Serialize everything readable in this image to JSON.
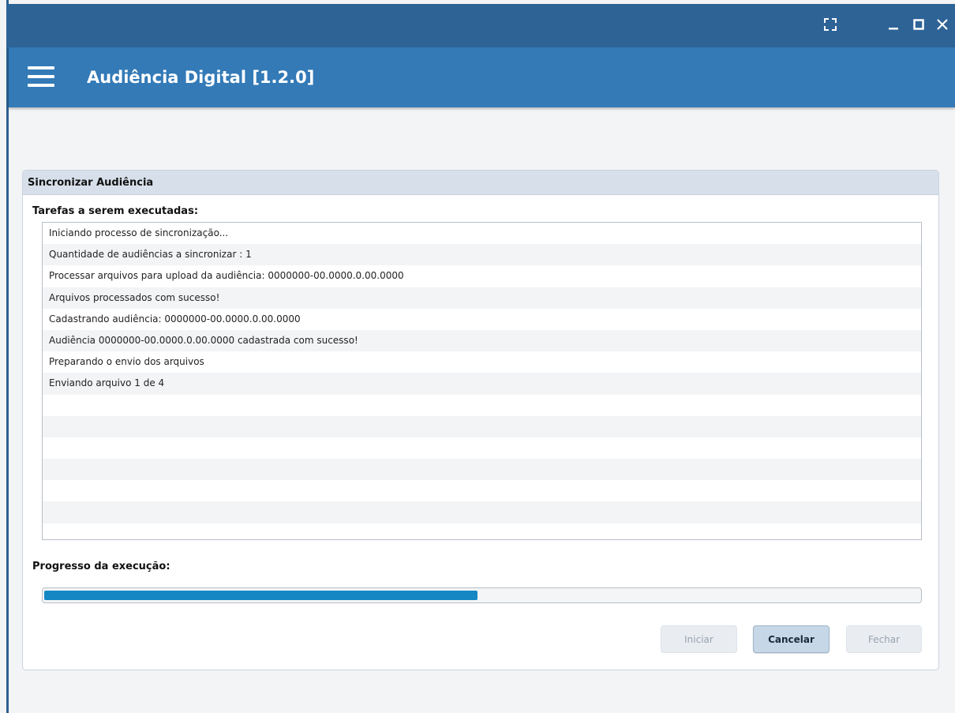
{
  "window": {
    "fullscreen_icon": "fullscreen-icon",
    "minimize_icon": "minimize-icon",
    "maximize_icon": "maximize-icon",
    "close_icon": "close-icon",
    "titlebar_color": "#2e6396"
  },
  "app": {
    "title": "Audiência Digital [1.2.0]",
    "menu_icon": "hamburger-menu-icon",
    "header_color": "#337ab7"
  },
  "panel": {
    "title": "Sincronizar Audiência",
    "tasks_label": "Tarefas a serem executadas:",
    "tasks": [
      "Iniciando processo de sincronização...",
      "Quantidade de audiências a sincronizar :  1",
      "Processar arquivos para upload da audiência: 0000000-00.0000.0.00.0000",
      "Arquivos processados com sucesso!",
      "Cadastrando audiência: 0000000-00.0000.0.00.0000",
      "Audiência 0000000-00.0000.0.00.0000 cadastrada com sucesso!",
      "Preparando o envio dos arquivos",
      "Enviando arquivo 1 de 4",
      "",
      "",
      "",
      "",
      "",
      "",
      ""
    ],
    "progress_label": "Progresso da execução:",
    "progress_fraction": 0.495,
    "progress_color": "#1588c4",
    "buttons": {
      "start": "Iniciar",
      "cancel": "Cancelar",
      "close": "Fechar"
    }
  }
}
